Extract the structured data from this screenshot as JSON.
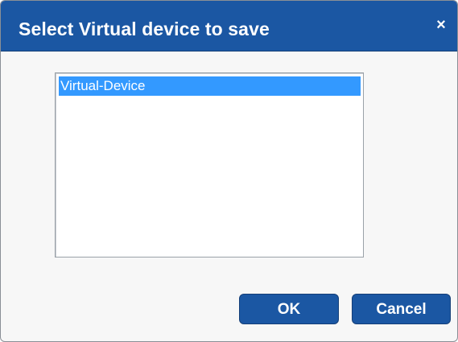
{
  "dialog": {
    "title": "Select Virtual device to save",
    "close_glyph": "×",
    "close_icon": "close-icon"
  },
  "device_list": {
    "items": [
      {
        "label": "Virtual-Device",
        "selected": true
      }
    ]
  },
  "buttons": {
    "ok_label": "OK",
    "cancel_label": "Cancel"
  },
  "colors": {
    "title_bar": "#1b57a3",
    "selection": "#3399ff",
    "button": "#1b57a3"
  }
}
